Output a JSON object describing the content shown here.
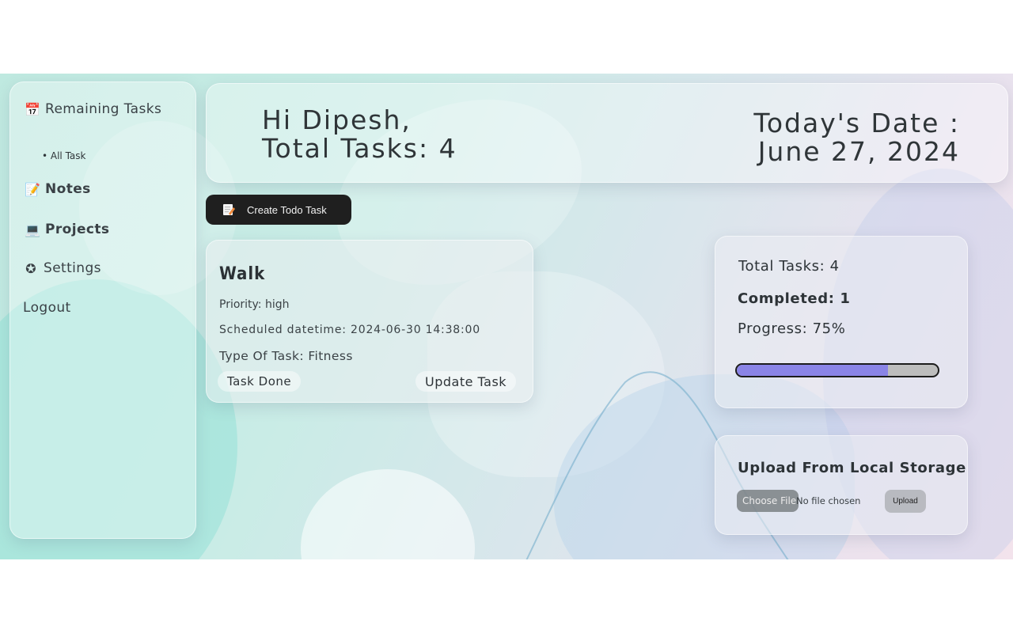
{
  "sidebar": {
    "items": [
      {
        "icon": "calendar-icon",
        "glyph": "📅",
        "label": "Remaining Tasks"
      },
      {
        "icon": "memo-icon",
        "glyph": "📝",
        "label": "Notes"
      },
      {
        "icon": "computer-icon",
        "glyph": "💻",
        "label": "Projects"
      },
      {
        "icon": "star-circle-icon",
        "glyph": "✪",
        "label": "Settings"
      },
      {
        "label": "Logout"
      }
    ],
    "sub_item": "• All Task"
  },
  "header": {
    "greeting": "Hi Dipesh,",
    "total_tasks": "Total Tasks: 4",
    "date_label": "Today's Date :",
    "date_value": "June 27, 2024"
  },
  "create_button": {
    "label": "Create Todo Task",
    "icon": "memo-icon"
  },
  "task_card": {
    "title": "Walk",
    "priority": "Priority: high",
    "scheduled": "Scheduled datetime: 2024-06-30 14:38:00",
    "type": "Type Of Task: Fitness",
    "done_label": "Task Done",
    "update_label": "Update Task"
  },
  "stats": {
    "total": "Total Tasks: 4",
    "completed": "Completed: 1",
    "progress_text": "Progress: 75%",
    "progress_value": 0.75,
    "progress_color": "#8a84e6"
  },
  "upload": {
    "title": "Upload From Local Storage",
    "choose_label": "Choose File",
    "no_file_text": "No file chosen",
    "upload_label": "Upload"
  }
}
